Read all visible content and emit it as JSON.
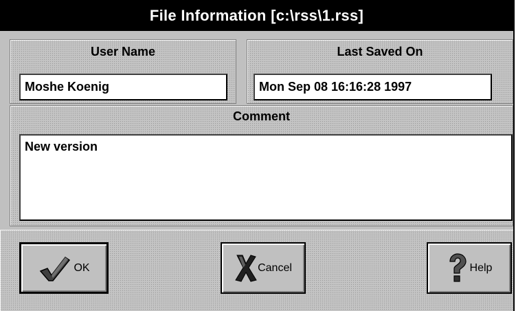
{
  "window": {
    "title": "File Information [c:\\rss\\1.rss]"
  },
  "user": {
    "label": "User Name",
    "value": "Moshe Koenig"
  },
  "saved": {
    "label": "Last Saved On",
    "value": "Mon Sep 08 16:16:28 1997"
  },
  "comment": {
    "label": "Comment",
    "value": "New version"
  },
  "buttons": {
    "ok": {
      "label": "OK",
      "icon": "checkmark-icon"
    },
    "cancel": {
      "label": "Cancel",
      "icon": "x-icon"
    },
    "help": {
      "label": "Help",
      "icon": "question-mark-icon"
    }
  }
}
